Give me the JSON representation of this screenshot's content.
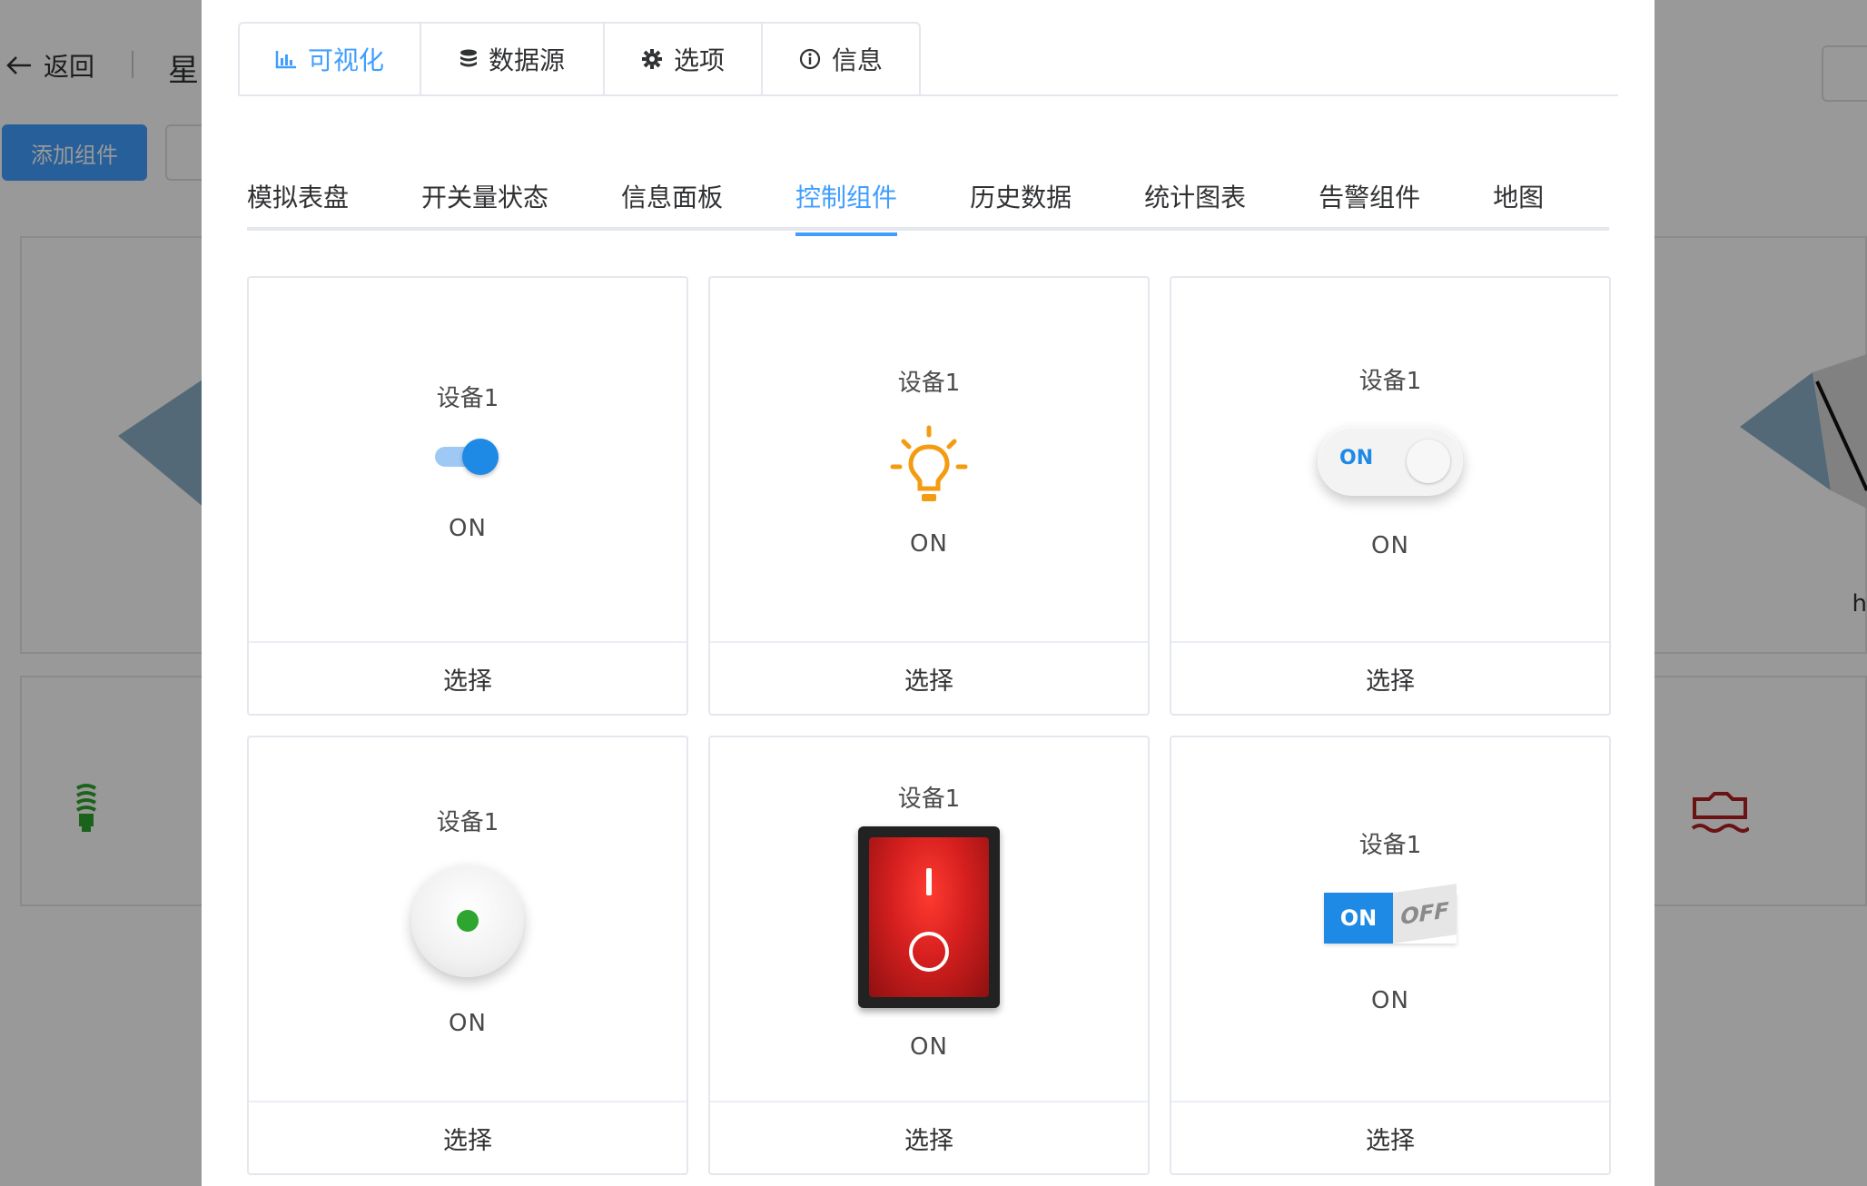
{
  "background": {
    "back_label": "返回",
    "title_char": "星",
    "add_component_label": "添加组件",
    "partial_h": "h"
  },
  "top_tabs": [
    {
      "icon": "bar-chart-icon",
      "label": "可视化",
      "active": true
    },
    {
      "icon": "database-icon",
      "label": "数据源",
      "active": false
    },
    {
      "icon": "gear-icon",
      "label": "选项",
      "active": false
    },
    {
      "icon": "info-icon",
      "label": "信息",
      "active": false
    }
  ],
  "sub_tabs": [
    {
      "label": "模拟表盘",
      "active": false
    },
    {
      "label": "开关量状态",
      "active": false
    },
    {
      "label": "信息面板",
      "active": false
    },
    {
      "label": "控制组件",
      "active": true
    },
    {
      "label": "历史数据",
      "active": false
    },
    {
      "label": "统计图表",
      "active": false
    },
    {
      "label": "告警组件",
      "active": false
    },
    {
      "label": "地图",
      "active": false
    }
  ],
  "cards": [
    {
      "device": "设备1",
      "state": "ON",
      "select_label": "选择"
    },
    {
      "device": "设备1",
      "state": "ON",
      "select_label": "选择"
    },
    {
      "device": "设备1",
      "state": "ON",
      "select_label": "选择",
      "pill_label": "ON"
    },
    {
      "device": "设备1",
      "state": "ON",
      "select_label": "选择"
    },
    {
      "device": "设备1",
      "state": "ON",
      "select_label": "选择"
    },
    {
      "device": "设备1",
      "state": "ON",
      "select_label": "选择",
      "on_label": "ON",
      "off_label": "OFF"
    }
  ],
  "colors": {
    "accent": "#409eff",
    "switch_blue": "#1e8ae6",
    "bulb_orange": "#f39c12",
    "green_dot": "#2ea52e",
    "rocker_red": "#d51f1f"
  }
}
